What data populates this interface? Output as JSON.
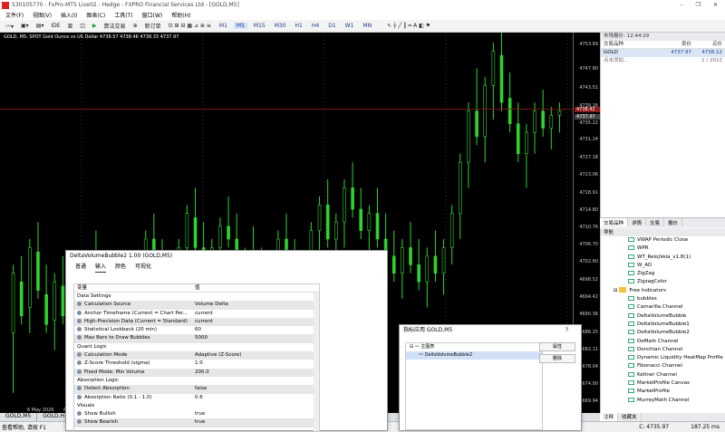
{
  "app": {
    "title": "530105770 - FxPro-MT5 Live02 - Hedge - FXPRO Financial Services Ltd - [GOLD,M5]",
    "controls": [
      "–",
      "❐",
      "✕"
    ]
  },
  "menu": [
    "文件(F)",
    "视图(V)",
    "插入(I)",
    "图表(C)",
    "工具(T)",
    "窗口(W)",
    "帮助(H)"
  ],
  "toolbar": {
    "algo": "算法交易",
    "neworder": "新订单",
    "timeframes": [
      "M1",
      "M5",
      "M15",
      "M30",
      "H1",
      "H4",
      "D1",
      "W1",
      "MN"
    ],
    "active": "M5"
  },
  "chart": {
    "info": "GOLD, M5:  SPOT Gold Ounce vs US Dollar  4738.57 4738.46 4738.33 4737.97",
    "price_labels": [
      "4753.69",
      "4747.80",
      "4743.51",
      "4739.26",
      "4735.22",
      "4731.24",
      "4727.18",
      "4723.06",
      "4718.91",
      "4714.80",
      "4710.76",
      "4706.70",
      "4702.60",
      "4698.52",
      "4694.42",
      "4690.36",
      "4686.25",
      "4682.11",
      "4678.04",
      "4674.00",
      "4669.94"
    ],
    "last_price": "4737.97",
    "bid_tag": "4738.42",
    "date_labels": [
      "6 May 2026",
      "6 May 16:00"
    ],
    "tabs": [
      "GOLD,M5",
      "GOLD,H1"
    ],
    "candles": [
      [
        4686,
        4700,
        4674
      ],
      [
        4698,
        4690,
        4702
      ],
      [
        4692,
        4706,
        4688
      ],
      [
        4705,
        4696,
        4710
      ],
      [
        4695,
        4688,
        4700
      ],
      [
        4689,
        4698,
        4684
      ],
      [
        4697,
        4690,
        4702
      ],
      [
        4689,
        4680,
        4692
      ],
      [
        4681,
        4692,
        4676
      ],
      [
        4691,
        4702,
        4688
      ],
      [
        4701,
        4694,
        4708
      ],
      [
        4694,
        4684,
        4698
      ],
      [
        4684,
        4690,
        4680
      ],
      [
        4690,
        4686,
        4696
      ],
      [
        4686,
        4694,
        4682
      ],
      [
        4694,
        4700,
        4690
      ],
      [
        4700,
        4708,
        4694
      ],
      [
        4708,
        4702,
        4712
      ],
      [
        4702,
        4696,
        4706
      ],
      [
        4696,
        4700,
        4692
      ],
      [
        4700,
        4706,
        4697
      ],
      [
        4706,
        4714,
        4702
      ],
      [
        4713,
        4706,
        4718
      ],
      [
        4706,
        4700,
        4710
      ],
      [
        4700,
        4706,
        4696
      ],
      [
        4706,
        4711,
        4702
      ],
      [
        4711,
        4708,
        4716
      ],
      [
        4708,
        4702,
        4712
      ],
      [
        4702,
        4704,
        4698
      ],
      [
        4704,
        4700,
        4709
      ],
      [
        4700,
        4696,
        4704
      ],
      [
        4696,
        4702,
        4692
      ],
      [
        4702,
        4708,
        4700
      ],
      [
        4708,
        4704,
        4712
      ],
      [
        4704,
        4698,
        4706
      ],
      [
        4698,
        4703,
        4695
      ],
      [
        4703,
        4710,
        4700
      ],
      [
        4710,
        4716,
        4706
      ],
      [
        4716,
        4708,
        4720
      ],
      [
        4708,
        4712,
        4704
      ],
      [
        4712,
        4720,
        4708
      ],
      [
        4720,
        4715,
        4724
      ],
      [
        4715,
        4710,
        4718
      ],
      [
        4710,
        4714,
        4706
      ],
      [
        4714,
        4708,
        4718
      ],
      [
        4708,
        4704,
        4712
      ],
      [
        4704,
        4700,
        4708
      ],
      [
        4700,
        4706,
        4696
      ],
      [
        4706,
        4702,
        4710
      ],
      [
        4702,
        4698,
        4706
      ],
      [
        4698,
        4704,
        4694
      ],
      [
        4704,
        4700,
        4708
      ],
      [
        4700,
        4706,
        4697
      ],
      [
        4706,
        4714,
        4704
      ],
      [
        4714,
        4726,
        4710
      ],
      [
        4726,
        4738,
        4722
      ],
      [
        4738,
        4732,
        4746
      ],
      [
        4732,
        4744,
        4728
      ],
      [
        4744,
        4752,
        4738
      ],
      [
        4751,
        4740,
        4755
      ],
      [
        4741,
        4735,
        4745
      ],
      [
        4735,
        4728,
        4738
      ],
      [
        4728,
        4733,
        4722
      ],
      [
        4733,
        4738,
        4730
      ],
      [
        4738,
        4734,
        4741
      ],
      [
        4734,
        4737,
        4731
      ],
      [
        4737,
        4738,
        4735
      ]
    ]
  },
  "market_watch": {
    "header": "市场报价: 12:44:29",
    "cols": [
      "交易品种",
      "卖价",
      "买价"
    ],
    "rows": [
      {
        "symbol": "GOLD",
        "bid": "4737.97",
        "ask": "4738.12"
      }
    ],
    "add": "点击添加...",
    "count": "1 / 2012",
    "tabs": [
      "交易品种",
      "详情",
      "交易",
      "报价"
    ]
  },
  "navigator": {
    "header": "导航",
    "items": [
      {
        "name": "VWAP Periodic Close",
        "type": "ind",
        "level": 2
      },
      {
        "name": "WPR",
        "type": "ind",
        "level": 2
      },
      {
        "name": "WT_RelojVela_v1.8(1)",
        "type": "ind",
        "level": 2
      },
      {
        "name": "W_AD",
        "type": "ind",
        "level": 2
      },
      {
        "name": "ZigZag",
        "type": "ind",
        "level": 2
      },
      {
        "name": "ZigzagColor",
        "type": "ind",
        "level": 2
      },
      {
        "name": "Free Indicators",
        "type": "folder",
        "level": 1
      },
      {
        "name": "bubbles",
        "type": "ind",
        "level": 2
      },
      {
        "name": "Camarilla Channel",
        "type": "ind",
        "level": 2
      },
      {
        "name": "DeltaVolumeBubble",
        "type": "ind",
        "level": 2
      },
      {
        "name": "DeltaVolumeBubble1",
        "type": "ind",
        "level": 2
      },
      {
        "name": "DeltaVolumeBubble2",
        "type": "ind",
        "level": 2
      },
      {
        "name": "DeMark Channel",
        "type": "ind",
        "level": 2
      },
      {
        "name": "Donchian Channel",
        "type": "ind",
        "level": 2
      },
      {
        "name": "Dynamic Liquidity HeatMap Profile",
        "type": "ind",
        "level": 2
      },
      {
        "name": "Fibonacci Channel",
        "type": "ind",
        "level": 2
      },
      {
        "name": "Keltner Channel",
        "type": "ind",
        "level": 2
      },
      {
        "name": "MarketProfile Canvas",
        "type": "ind",
        "level": 2
      },
      {
        "name": "MarketProfile",
        "type": "ind",
        "level": 2
      },
      {
        "name": "MurreyMath Channel",
        "type": "ind",
        "level": 2
      }
    ],
    "tabs": [
      "注释",
      "收藏夹"
    ]
  },
  "dialog": {
    "title": "DeltaVolumeBubble2 1.00 (GOLD,M5)",
    "tabs": [
      "普通",
      "输入",
      "颜色",
      "可视化"
    ],
    "active_tab": "输入",
    "headers": [
      "变量",
      "值"
    ],
    "rows": [
      {
        "name": "Data Settings",
        "value": "",
        "kind": "section"
      },
      {
        "name": "Calculation Source",
        "value": "Volume Delta",
        "kind": "enum"
      },
      {
        "name": "Anchor Timeframe (Current = Chart Per...",
        "value": "current",
        "kind": "enum"
      },
      {
        "name": "High-Precision Data (Current = Standard)",
        "value": "current",
        "kind": "enum"
      },
      {
        "name": "Statistical Lookback (20 min)",
        "value": "60",
        "kind": "num"
      },
      {
        "name": "Max Bars to Draw Bubbles",
        "value": "5000",
        "kind": "num"
      },
      {
        "name": "Quant Logic",
        "value": "",
        "kind": "section"
      },
      {
        "name": "Calculation Mode",
        "value": "Adaptive (Z-Score)",
        "kind": "enum"
      },
      {
        "name": "Z-Score Threshold (sigma)",
        "value": "1.0",
        "kind": "frac"
      },
      {
        "name": "Fixed Mode: Min Volume",
        "value": "200.0",
        "kind": "frac"
      },
      {
        "name": "Absorption Logic",
        "value": "",
        "kind": "section"
      },
      {
        "name": "Detect Absorption",
        "value": "false",
        "kind": "bool"
      },
      {
        "name": "Absorption Ratio (0.1 - 1.0)",
        "value": "0.6",
        "kind": "frac"
      },
      {
        "name": "Visuals",
        "value": "",
        "kind": "section"
      },
      {
        "name": "Show Bullish",
        "value": "true",
        "kind": "bool"
      },
      {
        "name": "Show Bearish",
        "value": "true",
        "kind": "bool"
      }
    ]
  },
  "indicator_window": {
    "title": "指标应用 GOLD,M5",
    "help": "?",
    "tree": [
      "主图表",
      "DeltaVolumeBubble2"
    ],
    "buttons": [
      "属性",
      "删除"
    ]
  },
  "status": {
    "help": "查看帮助, 请按 F1",
    "price": "C: 4735.97",
    "ping": "187.25 ms"
  }
}
